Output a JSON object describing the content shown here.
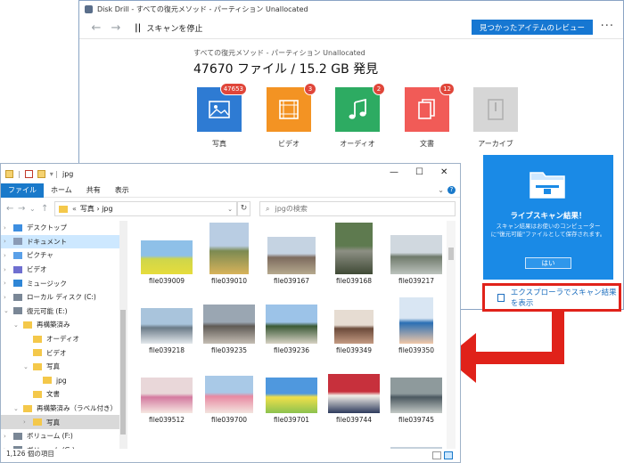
{
  "diskdrill": {
    "title": "Disk Drill - すべての復元メソッド - パーティション Unallocated",
    "pause_icon": "||",
    "stop_label": "スキャンを停止",
    "review_button": "見つかったアイテムのレビュー",
    "more_icon": "···",
    "subtitle": "すべての復元メソッド - パーティション Unallocated",
    "headline": "47670 ファイル / 15.2 GB 発見",
    "categories": [
      {
        "label": "写真",
        "badge": "47653",
        "color": "#2e7bd3",
        "icon": "image-icon"
      },
      {
        "label": "ビデオ",
        "badge": "3",
        "color": "#f39323",
        "icon": "film-icon"
      },
      {
        "label": "オーディオ",
        "badge": "2",
        "color": "#2dab62",
        "icon": "music-note-icon"
      },
      {
        "label": "文書",
        "badge": "12",
        "color": "#f15b57",
        "icon": "document-icon"
      },
      {
        "label": "アーカイブ",
        "badge": "",
        "color": "#d6d6d6",
        "icon": "archive-icon"
      }
    ]
  },
  "notification": {
    "title": "ライブスキャン結果！",
    "body": "スキャン結果はお使いのコンピューターに\"復元可能\"ファイルとして保存されます。",
    "ok_button": "はい",
    "explorer_link": "エクスプローラでスキャン結果を表示"
  },
  "explorer": {
    "title": "jpg",
    "window_controls": {
      "minimize": "—",
      "maximize": "☐",
      "close": "✕"
    },
    "ribbon_tabs": [
      "ファイル",
      "ホーム",
      "共有",
      "表示"
    ],
    "nav_back": "←",
    "nav_forward": "→",
    "nav_up": "↑",
    "address_prefix": "«",
    "address_path": "写真 › jpg",
    "search_placeholder": "jpgの検索",
    "tree": [
      {
        "label": "デスクトップ",
        "indent": 0,
        "icon": "desktop",
        "expander": "›"
      },
      {
        "label": "ドキュメント",
        "indent": 0,
        "icon": "documents",
        "expander": "›",
        "selected": true
      },
      {
        "label": "ピクチャ",
        "indent": 0,
        "icon": "pictures",
        "expander": "›"
      },
      {
        "label": "ビデオ",
        "indent": 0,
        "icon": "videos",
        "expander": "›"
      },
      {
        "label": "ミュージック",
        "indent": 0,
        "icon": "music",
        "expander": "›"
      },
      {
        "label": "ローカル ディスク (C:)",
        "indent": 0,
        "icon": "drive",
        "expander": "›"
      },
      {
        "label": "復元可能 (E:)",
        "indent": 0,
        "icon": "drive",
        "expander": "⌄"
      },
      {
        "label": "再構築済み",
        "indent": 1,
        "icon": "folder",
        "expander": "⌄"
      },
      {
        "label": "オーディオ",
        "indent": 2,
        "icon": "folder",
        "expander": ""
      },
      {
        "label": "ビデオ",
        "indent": 2,
        "icon": "folder",
        "expander": ""
      },
      {
        "label": "写真",
        "indent": 2,
        "icon": "folder",
        "expander": "⌄"
      },
      {
        "label": "jpg",
        "indent": 3,
        "icon": "folder",
        "expander": ""
      },
      {
        "label": "文書",
        "indent": 2,
        "icon": "folder",
        "expander": ""
      },
      {
        "label": "再構築済み（ラベル付き）",
        "indent": 1,
        "icon": "folder",
        "expander": "⌄"
      },
      {
        "label": "写真",
        "indent": 2,
        "icon": "folder",
        "expander": "›",
        "selected2": true
      },
      {
        "label": "ボリューム (F:)",
        "indent": 0,
        "icon": "drive",
        "expander": "›"
      },
      {
        "label": "ボリューム (G:)",
        "indent": 0,
        "icon": "drive",
        "expander": "›"
      }
    ],
    "files": [
      {
        "name": "file039009",
        "palette": [
          "#8ec0e8",
          "#cfd64a",
          "#e6dc3c"
        ]
      },
      {
        "name": "file039010",
        "palette": [
          "#b9cde3",
          "#7c8a52",
          "#d8b35a"
        ]
      },
      {
        "name": "file039167",
        "palette": [
          "#c5d3e2",
          "#7d6b5e",
          "#b6a98e"
        ]
      },
      {
        "name": "file039168",
        "palette": [
          "#5e7a4f",
          "#8d8f84",
          "#3f4a35"
        ]
      },
      {
        "name": "file039217",
        "palette": [
          "#d0d8df",
          "#6f7a6b",
          "#bcc3bd"
        ]
      },
      {
        "name": "file039218",
        "palette": [
          "#a9c4dc",
          "#6b7b88",
          "#e3e8ec"
        ]
      },
      {
        "name": "file039235",
        "palette": [
          "#9aa6b2",
          "#5f5a55",
          "#c5beb4"
        ]
      },
      {
        "name": "file039236",
        "palette": [
          "#9cc3e8",
          "#3b5a37",
          "#d7d2c4"
        ]
      },
      {
        "name": "file039349",
        "palette": [
          "#e6dcd2",
          "#6b4a3a",
          "#c49b83"
        ]
      },
      {
        "name": "file039350",
        "palette": [
          "#d9e6f3",
          "#2a6fb4",
          "#f1c8a8"
        ]
      },
      {
        "name": "file039512",
        "palette": [
          "#e9d7d9",
          "#d47aa0",
          "#f6e8e2"
        ]
      },
      {
        "name": "file039700",
        "palette": [
          "#a9c9e7",
          "#e889a2",
          "#f3e4df"
        ]
      },
      {
        "name": "file039701",
        "palette": [
          "#4f98de",
          "#f0e04a",
          "#8cc24f"
        ]
      },
      {
        "name": "file039744",
        "palette": [
          "#c7303c",
          "#f3efe8",
          "#2d3a5c"
        ]
      },
      {
        "name": "file039745",
        "palette": [
          "#8e9a9c",
          "#4c5960",
          "#c3c9c6"
        ]
      },
      {
        "name": "",
        "palette": [
          "#cfd8df",
          "#a0806a",
          "#e4d1c0"
        ]
      },
      {
        "name": "",
        "palette": [
          "#cdb9a9",
          "#4a3a32",
          "#e7c9ad"
        ]
      },
      {
        "name": "",
        "palette": [
          "#6fa8dc",
          "#e7eef7",
          "#9cc7ef"
        ]
      },
      {
        "name": "",
        "palette": [
          "#b6c6d3",
          "#2f3d4a",
          "#e0d8cf"
        ]
      },
      {
        "name": "",
        "palette": [
          "#c5d1dc",
          "#4b5963",
          "#9aa8b1"
        ]
      }
    ],
    "status": "1,126 個の項目"
  }
}
